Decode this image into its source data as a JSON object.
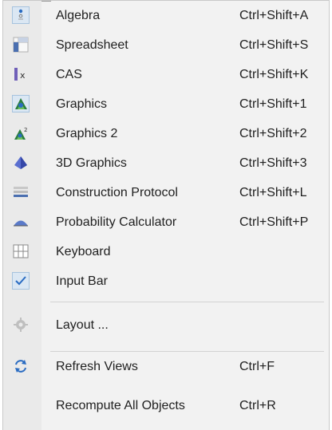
{
  "menu": {
    "items": [
      {
        "label": "Algebra",
        "shortcut": "Ctrl+Shift+A",
        "icon": "algebra-view-icon",
        "selected": true
      },
      {
        "label": "Spreadsheet",
        "shortcut": "Ctrl+Shift+S",
        "icon": "spreadsheet-view-icon",
        "selected": false
      },
      {
        "label": "CAS",
        "shortcut": "Ctrl+Shift+K",
        "icon": "cas-view-icon",
        "selected": false
      },
      {
        "label": "Graphics",
        "shortcut": "Ctrl+Shift+1",
        "icon": "graphics-view-icon",
        "selected": true
      },
      {
        "label": "Graphics 2",
        "shortcut": "Ctrl+Shift+2",
        "icon": "graphics-2-view-icon",
        "selected": false
      },
      {
        "label": "3D Graphics",
        "shortcut": "Ctrl+Shift+3",
        "icon": "3d-graphics-view-icon",
        "selected": false
      },
      {
        "label": "Construction Protocol",
        "shortcut": "Ctrl+Shift+L",
        "icon": "construction-protocol-icon",
        "selected": false
      },
      {
        "label": "Probability Calculator",
        "shortcut": "Ctrl+Shift+P",
        "icon": "probability-calculator-icon",
        "selected": false
      },
      {
        "label": "Keyboard",
        "shortcut": "",
        "icon": "keyboard-icon",
        "selected": false
      },
      {
        "label": "Input Bar",
        "shortcut": "",
        "icon": "checkmark-icon",
        "selected": true
      }
    ],
    "layout": {
      "label": "Layout ...",
      "icon": "gear-icon"
    },
    "refresh": {
      "label": "Refresh Views",
      "shortcut": "Ctrl+F",
      "icon": "refresh-icon"
    },
    "recompute": {
      "label": "Recompute All Objects",
      "shortcut": "Ctrl+R"
    }
  },
  "colors": {
    "menu_bg": "#f2f2f2",
    "icon_strip": "#eaeaea",
    "selection_bg": "#dbe7f3",
    "selection_border": "#a7c3de",
    "accent_blue": "#2a6cc2"
  }
}
